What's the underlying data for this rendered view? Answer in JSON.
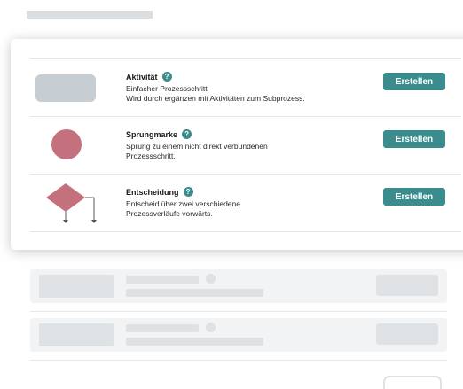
{
  "popover": {
    "items": [
      {
        "title": "Aktivität",
        "help": "?",
        "description": "Einfacher Prozessschritt\nWird durch ergänzen mit Aktivitäten zum Subprozess.",
        "button": "Erstellen",
        "shape": "rounded-rectangle"
      },
      {
        "title": "Sprungmarke",
        "help": "?",
        "description": "Sprung zu einem nicht direkt verbundenen\nProzessschritt.",
        "button": "Erstellen",
        "shape": "circle"
      },
      {
        "title": "Entscheidung",
        "help": "?",
        "description": "Entscheid über zwei verschiedene\nProzessverläufe vorwärts.",
        "button": "Erstellen",
        "shape": "diamond"
      }
    ]
  },
  "colors": {
    "accent": "#3b8c8c",
    "activity_shape": "#c7ced3",
    "jump_shape": "#c4707d",
    "decision_shape": "#c4707d",
    "skeleton": "#dfe2e4"
  }
}
